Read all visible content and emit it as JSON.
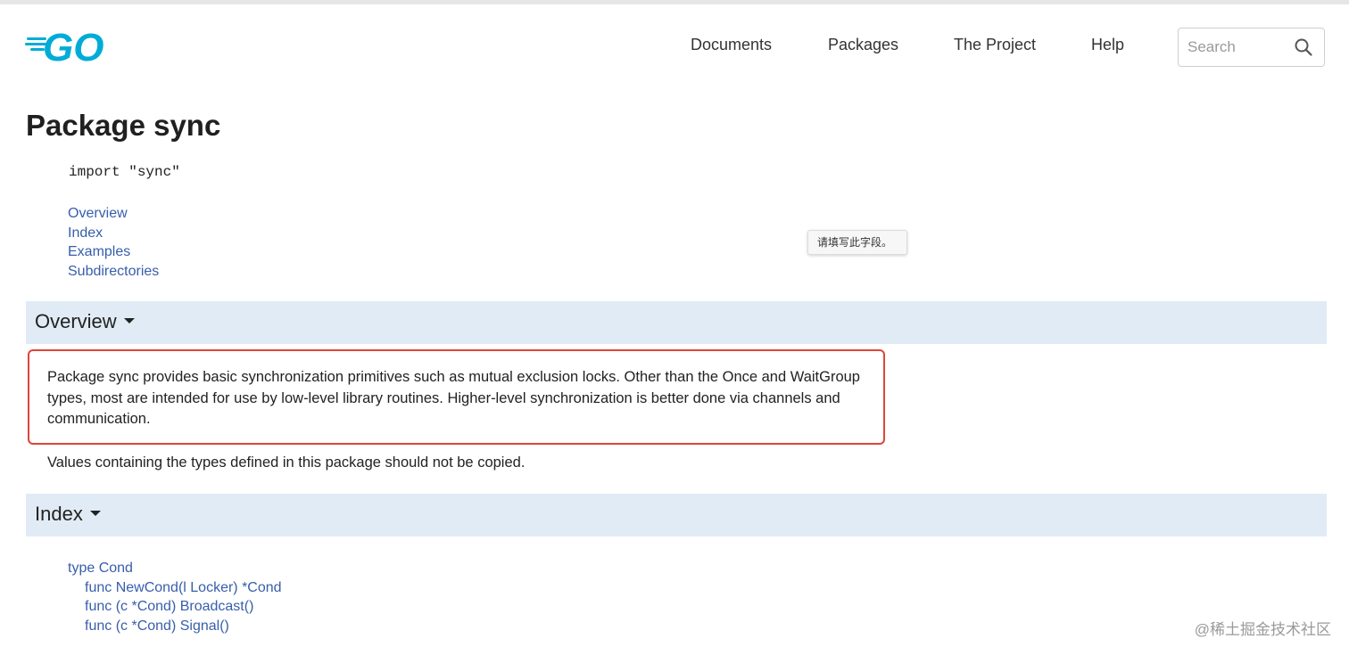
{
  "header": {
    "logo_text": "GO",
    "nav": [
      {
        "label": "Documents"
      },
      {
        "label": "Packages"
      },
      {
        "label": "The Project"
      },
      {
        "label": "Help"
      }
    ],
    "search": {
      "placeholder": "Search",
      "value": ""
    }
  },
  "page": {
    "title": "Package sync",
    "import_statement": "import \"sync\"",
    "toc": [
      {
        "label": "Overview"
      },
      {
        "label": "Index"
      },
      {
        "label": "Examples"
      },
      {
        "label": "Subdirectories"
      }
    ]
  },
  "tooltip": {
    "text": "请填写此字段。"
  },
  "overview": {
    "heading": "Overview",
    "highlighted_paragraph": "Package sync provides basic synchronization primitives such as mutual exclusion locks. Other than the Once and WaitGroup types, most are intended for use by low-level library routines. Higher-level synchronization is better done via channels and communication.",
    "note": "Values containing the types defined in this package should not be copied."
  },
  "index": {
    "heading": "Index",
    "items": [
      {
        "label": "type Cond",
        "indent": false
      },
      {
        "label": "func NewCond(l Locker) *Cond",
        "indent": true
      },
      {
        "label": "func (c *Cond) Broadcast()",
        "indent": true
      },
      {
        "label": "func (c *Cond) Signal()",
        "indent": true
      }
    ]
  },
  "watermark": "@稀土掘金技术社区",
  "colors": {
    "logo": "#00acd7",
    "link": "#375eab",
    "section_bar": "#e0ebf5",
    "highlight_border": "#e0433a"
  },
  "icons": [
    "go-gopher-logo",
    "search-icon",
    "chevron-down-icon"
  ]
}
